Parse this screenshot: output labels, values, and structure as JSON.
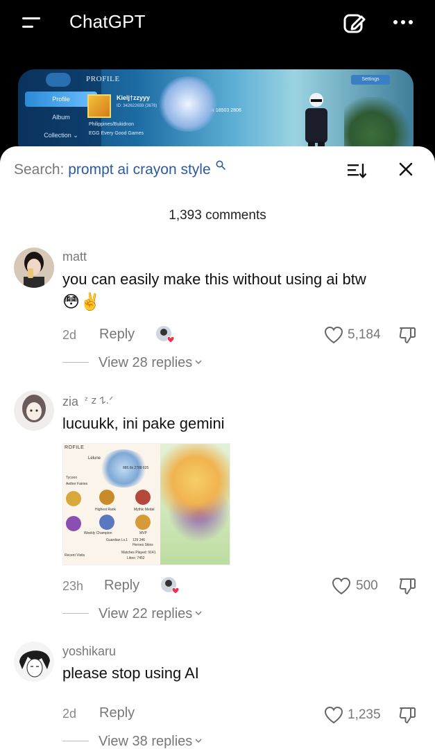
{
  "app": {
    "title": "ChatGPT"
  },
  "banner": {
    "profile_heading": "PROFILE",
    "settings_label": "Settings",
    "tabs": [
      "Profile",
      "Album",
      "Collection ⌄"
    ],
    "player_name": "Kielj†zzyyy",
    "player_id": "ID: 342622659 (3678)",
    "stats": "2468.5k  18503  2806",
    "location": "Philippines/Bukidnon",
    "squad": "EGG  Every Good Games"
  },
  "search": {
    "label": "Search:",
    "query": "prompt ai crayon style"
  },
  "comments_count": "1,393 comments",
  "comments": [
    {
      "username": "matt",
      "text": "you can easily make this without using ai btw",
      "emoji": "😳✌️",
      "time": "2d",
      "reply_label": "Reply",
      "likes": "5,184",
      "view_replies": "View 28 replies"
    },
    {
      "username": "zia",
      "username_suffix": "ᶻ 𝗓 𐰁.ᐟ",
      "text": "lucuukk, ini pake gemini",
      "time": "23h",
      "reply_label": "Reply",
      "likes": "500",
      "view_replies": "View 22 replies",
      "attachment": {
        "title": "ROFILE",
        "name": "Lėlune",
        "stats": "885.6k  2788  625",
        "rows": [
          "Tycoon",
          "Aether Fairies",
          "Highest Rank",
          "Mythic Medal",
          "Weekly Champion",
          "Guardian Lv.1",
          "MVP",
          "129  346",
          "Heroes  Skins",
          "Matches Played: 9141",
          "Likes: 7452",
          "Recent Visits"
        ]
      }
    },
    {
      "username": "yoshikaru",
      "text": "please stop using AI",
      "time": "2d",
      "reply_label": "Reply",
      "likes": "1,235",
      "view_replies": "View 38 replies"
    }
  ],
  "colors": {
    "query": "#2c5aa0",
    "muted": "#777777",
    "creator_like_heart": "#e8344e"
  }
}
